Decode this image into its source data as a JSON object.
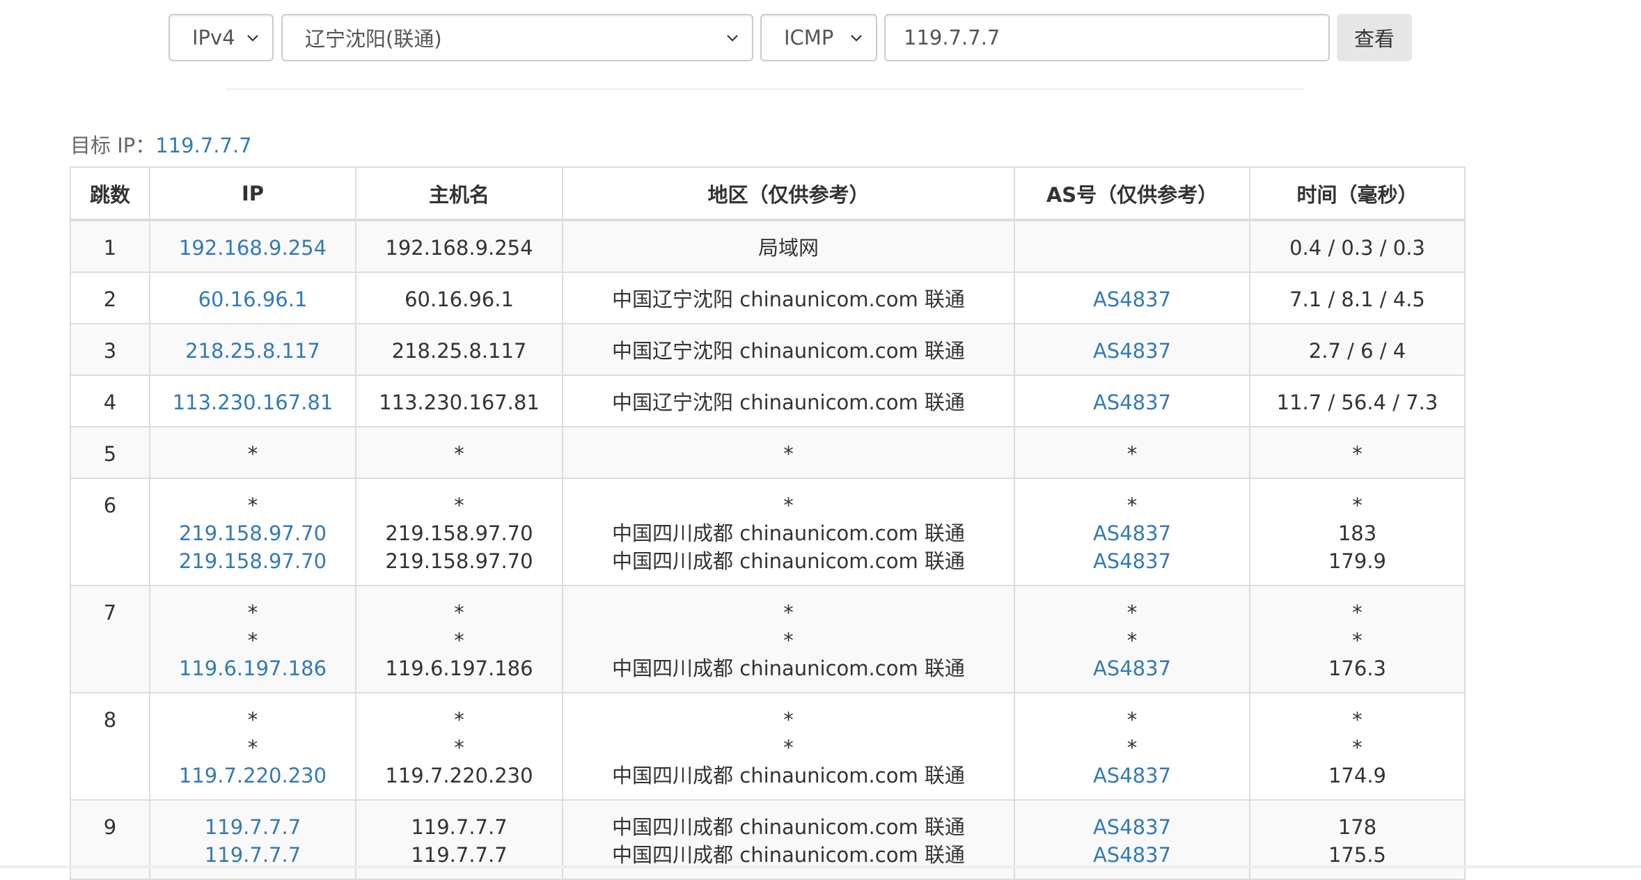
{
  "toolbar": {
    "ip_version": "IPv4",
    "location": "辽宁沈阳(联通)",
    "protocol": "ICMP",
    "target_value": "119.7.7.7",
    "view_label": "查看"
  },
  "target": {
    "label": "目标 IP：",
    "ip": "119.7.7.7"
  },
  "table": {
    "headers": [
      "跳数",
      "IP",
      "主机名",
      "地区（仅供参考）",
      "AS号（仅供参考）",
      "时间（毫秒）"
    ],
    "rows": [
      {
        "hop": "1",
        "ip": [
          "192.168.9.254"
        ],
        "host": [
          "192.168.9.254"
        ],
        "region": [
          "局域网"
        ],
        "as": [
          ""
        ],
        "time": [
          "0.4 / 0.3 / 0.3"
        ]
      },
      {
        "hop": "2",
        "ip": [
          "60.16.96.1"
        ],
        "host": [
          "60.16.96.1"
        ],
        "region": [
          "中国辽宁沈阳 chinaunicom.com 联通"
        ],
        "as": [
          "AS4837"
        ],
        "time": [
          "7.1 / 8.1 / 4.5"
        ]
      },
      {
        "hop": "3",
        "ip": [
          "218.25.8.117"
        ],
        "host": [
          "218.25.8.117"
        ],
        "region": [
          "中国辽宁沈阳 chinaunicom.com 联通"
        ],
        "as": [
          "AS4837"
        ],
        "time": [
          "2.7 / 6 / 4"
        ]
      },
      {
        "hop": "4",
        "ip": [
          "113.230.167.81"
        ],
        "host": [
          "113.230.167.81"
        ],
        "region": [
          "中国辽宁沈阳 chinaunicom.com 联通"
        ],
        "as": [
          "AS4837"
        ],
        "time": [
          "11.7 / 56.4 / 7.3"
        ]
      },
      {
        "hop": "5",
        "ip": [
          "*"
        ],
        "host": [
          "*"
        ],
        "region": [
          "*"
        ],
        "as": [
          "*"
        ],
        "time": [
          "*"
        ]
      },
      {
        "hop": "6",
        "ip": [
          "*",
          "219.158.97.70",
          "219.158.97.70"
        ],
        "host": [
          "*",
          "219.158.97.70",
          "219.158.97.70"
        ],
        "region": [
          "*",
          "中国四川成都 chinaunicom.com 联通",
          "中国四川成都 chinaunicom.com 联通"
        ],
        "as": [
          "*",
          "AS4837",
          "AS4837"
        ],
        "time": [
          "*",
          "183",
          "179.9"
        ]
      },
      {
        "hop": "7",
        "ip": [
          "*",
          "*",
          "119.6.197.186"
        ],
        "host": [
          "*",
          "*",
          "119.6.197.186"
        ],
        "region": [
          "*",
          "*",
          "中国四川成都 chinaunicom.com 联通"
        ],
        "as": [
          "*",
          "*",
          "AS4837"
        ],
        "time": [
          "*",
          "*",
          "176.3"
        ]
      },
      {
        "hop": "8",
        "ip": [
          "*",
          "*",
          "119.7.220.230"
        ],
        "host": [
          "*",
          "*",
          "119.7.220.230"
        ],
        "region": [
          "*",
          "*",
          "中国四川成都 chinaunicom.com 联通"
        ],
        "as": [
          "*",
          "*",
          "AS4837"
        ],
        "time": [
          "*",
          "*",
          "174.9"
        ]
      },
      {
        "hop": "9",
        "ip": [
          "119.7.7.7",
          "119.7.7.7"
        ],
        "host": [
          "119.7.7.7",
          "119.7.7.7"
        ],
        "region": [
          "中国四川成都 chinaunicom.com 联通",
          "中国四川成都 chinaunicom.com 联通"
        ],
        "as": [
          "AS4837",
          "AS4837"
        ],
        "time": [
          "178",
          "175.5"
        ]
      }
    ]
  },
  "colors": {
    "link": "#337ab7",
    "row_alt": "#f9f9f9",
    "border": "#dddddd",
    "button_bg": "#e6e6e6"
  },
  "icons": {
    "select_arrow": "chevron-down-icon"
  }
}
